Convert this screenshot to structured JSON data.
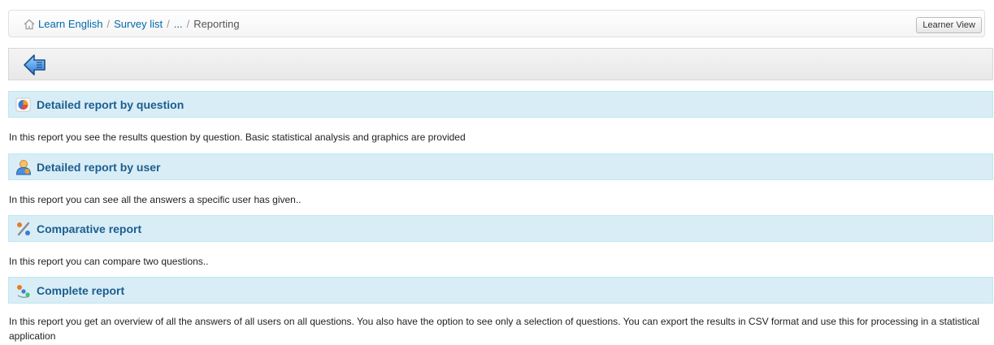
{
  "breadcrumb": {
    "items": [
      {
        "label": "Learn English"
      },
      {
        "label": "Survey list"
      },
      {
        "label": "..."
      },
      {
        "label": "Reporting"
      }
    ],
    "separator": "/"
  },
  "header": {
    "learner_view_label": "Learner View"
  },
  "toolbar": {
    "back_icon": "back-arrow-icon"
  },
  "colors": {
    "link": "#0069a9",
    "section_bg": "#d9edf7",
    "section_border": "#bce8f1",
    "section_title": "#1b5e8e"
  },
  "reports": [
    {
      "title": "Detailed report by question",
      "icon": "pie-chart-icon",
      "description": "In this report you see the results question by question. Basic statistical analysis and graphics are provided"
    },
    {
      "title": "Detailed report by user",
      "icon": "user-icon",
      "description": "In this report you can see all the answers a specific user has given.."
    },
    {
      "title": "Comparative report",
      "icon": "percent-icon",
      "description": "In this report you can compare two questions.."
    },
    {
      "title": "Complete report",
      "icon": "complete-report-icon",
      "description": "In this report you get an overview of all the answers of all users on all questions. You also have the option to see only a selection of questions. You can export the results in CSV format and use this for processing in a statistical application"
    }
  ]
}
